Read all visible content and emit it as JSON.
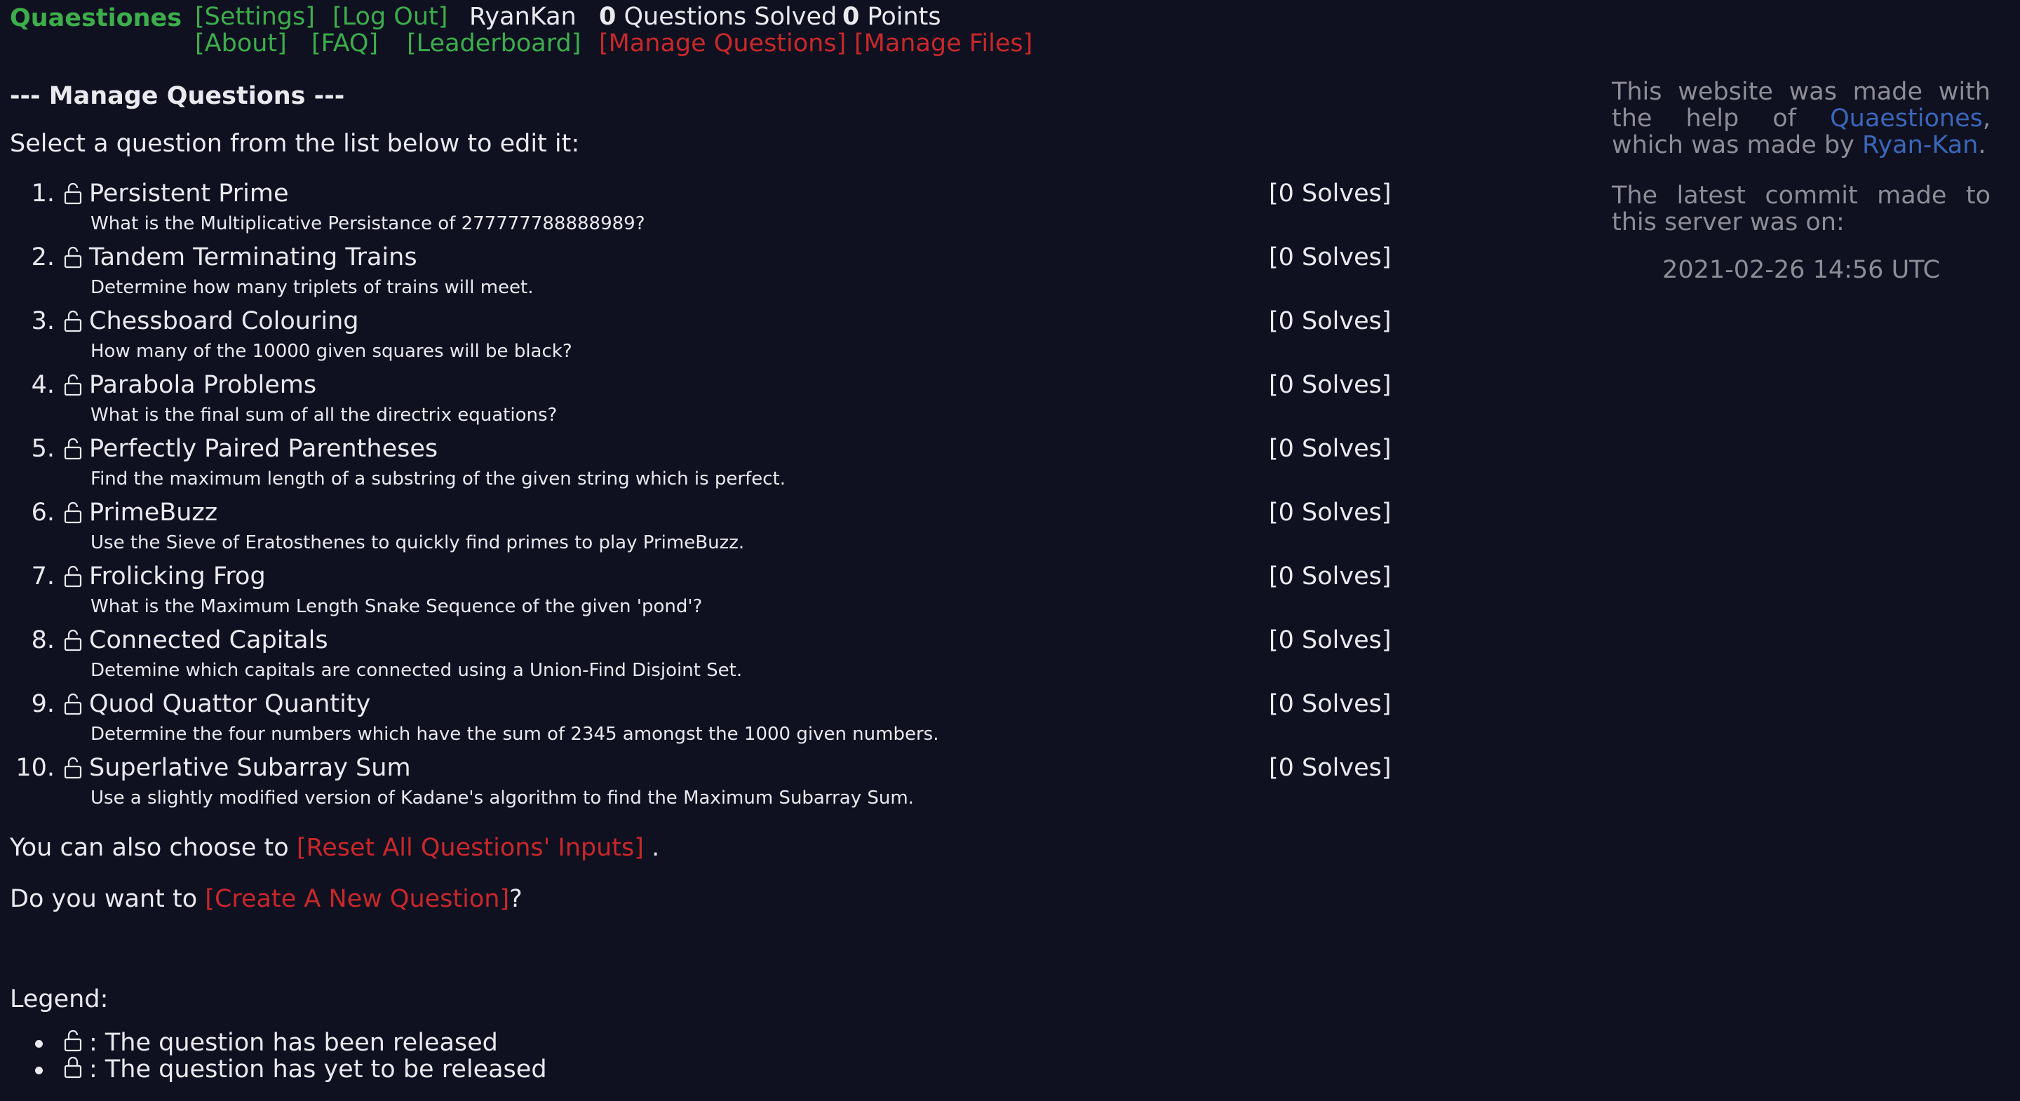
{
  "header": {
    "brand": "Quaestiones",
    "nav_row1": {
      "settings": "[Settings]",
      "logout": "[Log Out]",
      "username": "RyanKan",
      "solved_count": "0",
      "solved_label": " Questions Solved",
      "points_count": "0",
      "points_label": " Points"
    },
    "nav_row2": {
      "about": "[About]",
      "faq": "[FAQ]",
      "leaderboard": "[Leaderboard]",
      "manage_questions": "[Manage Questions]",
      "manage_files": "[Manage Files]"
    }
  },
  "main": {
    "heading": "--- Manage Questions ---",
    "intro": "Select a question from the list below to edit it:",
    "questions": [
      {
        "num": "1.",
        "title": "Persistent Prime",
        "desc": "What is the Multiplicative Persistance of 277777788888989?",
        "solves": "[0 Solves]"
      },
      {
        "num": "2.",
        "title": "Tandem Terminating Trains",
        "desc": "Determine how many triplets of trains will meet.",
        "solves": "[0 Solves]"
      },
      {
        "num": "3.",
        "title": "Chessboard Colouring",
        "desc": "How many of the 10000 given squares will be black?",
        "solves": "[0 Solves]"
      },
      {
        "num": "4.",
        "title": "Parabola Problems",
        "desc": "What is the final sum of all the directrix equations?",
        "solves": "[0 Solves]"
      },
      {
        "num": "5.",
        "title": "Perfectly Paired Parentheses",
        "desc": "Find the maximum length of a substring of the given string which is perfect.",
        "solves": "[0 Solves]"
      },
      {
        "num": "6.",
        "title": "PrimeBuzz",
        "desc": "Use the Sieve of Eratosthenes to quickly find primes to play PrimeBuzz.",
        "solves": "[0 Solves]"
      },
      {
        "num": "7.",
        "title": "Frolicking Frog",
        "desc": "What is the Maximum Length Snake Sequence of the given 'pond'?",
        "solves": "[0 Solves]"
      },
      {
        "num": "8.",
        "title": "Connected Capitals",
        "desc": "Detemine which capitals are connected using a Union-Find Disjoint Set.",
        "solves": "[0 Solves]"
      },
      {
        "num": "9.",
        "title": "Quod Quattor Quantity",
        "desc": "Determine the four numbers which have the sum of 2345 amongst the 1000 given numbers.",
        "solves": "[0 Solves]"
      },
      {
        "num": "10.",
        "title": "Superlative Subarray Sum",
        "desc": "Use a slightly modified version of Kadane's algorithm to find the Maximum Subarray Sum.",
        "solves": "[0 Solves]"
      }
    ],
    "reset_prefix": "You can also choose to ",
    "reset_link": "[Reset All Questions' Inputs]",
    "reset_suffix": " .",
    "create_prefix": "Do you want to ",
    "create_link": "[Create A New Question]",
    "create_suffix": "?",
    "legend_title": "Legend:",
    "legend_items": [
      {
        "icon": "unlocked-icon",
        "text": ": The question has been released"
      },
      {
        "icon": "lock-icon",
        "text": ": The question has yet to be released"
      }
    ]
  },
  "sidebar": {
    "p1_pre": "This website was made with the help of ",
    "p1_link1": "Quaestiones",
    "p1_mid": ", which was made by ",
    "p1_link2": "Ryan-Kan",
    "p1_post": ".",
    "p2": "The latest commit made to this server was on:",
    "date": "2021-02-26 14:56 UTC"
  },
  "colors": {
    "background": "#0f1020",
    "text": "#e9e9ee",
    "link_green": "#3cae4b",
    "link_red": "#c8282a",
    "link_blue": "#3a67b9",
    "muted": "#8d8d96"
  }
}
